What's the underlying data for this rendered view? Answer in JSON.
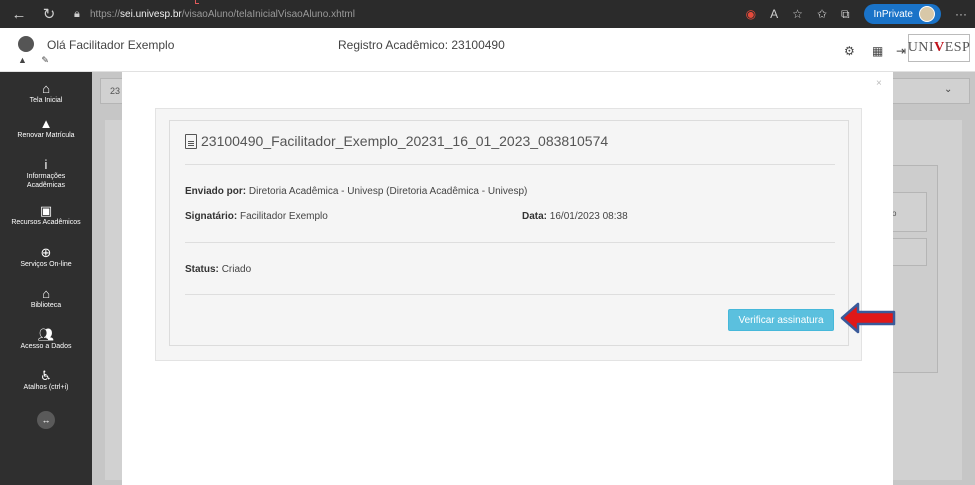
{
  "browser": {
    "url_protocol": "https://",
    "url_host": "sei.univesp.br",
    "url_path": "/visaoAluno/telaInicialVisaoAluno.xhtml",
    "inprivate_label": "InPrivate",
    "more_label": "···"
  },
  "header": {
    "greeting": "Olá Facilitador Exemplo",
    "registro": "Registro Acadêmico: 23100490",
    "logo_text_left": "UNI",
    "logo_text_v": "V",
    "logo_text_right": "ESP"
  },
  "sidebar": {
    "items": [
      {
        "label": "Tela Inicial",
        "icon": "home-icon"
      },
      {
        "label": "Renovar Matrícula",
        "icon": "warning-icon"
      },
      {
        "label": "Informações Acadêmicas",
        "icon": "info-icon"
      },
      {
        "label": "Recursos Acadêmicos",
        "icon": "book-icon"
      },
      {
        "label": "Serviços On-line",
        "icon": "globe-icon"
      },
      {
        "label": "Biblioteca",
        "icon": "library-icon"
      },
      {
        "label": "Acesso a Dados",
        "icon": "users-icon"
      },
      {
        "label": "Atalhos (ctrl+i)",
        "icon": "accessibility-icon"
      }
    ],
    "expand_icon": "expand-icon"
  },
  "background": {
    "top_text": "23",
    "box_text": "o"
  },
  "modal": {
    "close_label": "×",
    "doc_title": "23100490_Facilitador_Exemplo_20231_16_01_2023_083810574",
    "sent_by_label": "Enviado por:",
    "sent_by_value": "Diretoria Acadêmica - Univesp (Diretoria Acadêmica - Univesp)",
    "signer_label": "Signatário:",
    "signer_value": "Facilitador Exemplo",
    "date_label": "Data:",
    "date_value": "16/01/2023 08:38",
    "status_label": "Status:",
    "status_value": "Criado",
    "verify_button": "Verificar assinatura"
  },
  "colors": {
    "sidebar_bg": "#2f2f2f",
    "verify_button": "#5bc0de",
    "arrow_red": "#e01818",
    "arrow_outline": "#3a5a9a"
  }
}
